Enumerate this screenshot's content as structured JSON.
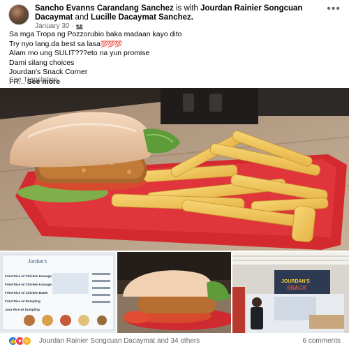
{
  "post": {
    "author": "Sancho Evanns Carandang Sanchez",
    "with_text": "is with",
    "tagged_1": "Jourdan Rainier Songcuan Dacaymat",
    "and_text": "and",
    "tagged_2": "Lucille Dacaymat Sanchez.",
    "date": "January 30 ·",
    "audience_icon": "friends-icon",
    "lines": [
      "Sa mga Tropa ng Pozzorubio baka madaan kayo dito",
      "Try nyo lang.da best sa lasa",
      "Alam mo ung SULIT???eto na yun promise",
      "Dami silang choices",
      "Jourdan's Snack Corner",
      "FR..."
    ],
    "hearts": "💯💯💯",
    "see_more": "See more",
    "see_translation": "See Translation"
  },
  "photos": {
    "main": "burger-and-fries-photo",
    "thumbs": [
      "menu-board-photo",
      "burger-closeup-photo",
      "snack-stall-photo"
    ]
  },
  "menu_items": [
    "Fried Rice w/ Chicken Karaage",
    "Fried Rice w/ Chicken Karaage",
    "Fried Rice w/ Chicken Batter",
    "Fried Rice w/ Dumpling",
    "Java Rice w/ Dumpling"
  ],
  "reactions": {
    "icons": [
      "like",
      "love",
      "haha"
    ],
    "names": "Jourdan Rainier Songcuan Dacaymat and 34 others",
    "comments": "6 comments"
  },
  "colors": {
    "text": "#050505",
    "secondary": "#65676b",
    "like": "#1877f2",
    "love": "#f33e58",
    "plate": "#d42a2f"
  }
}
